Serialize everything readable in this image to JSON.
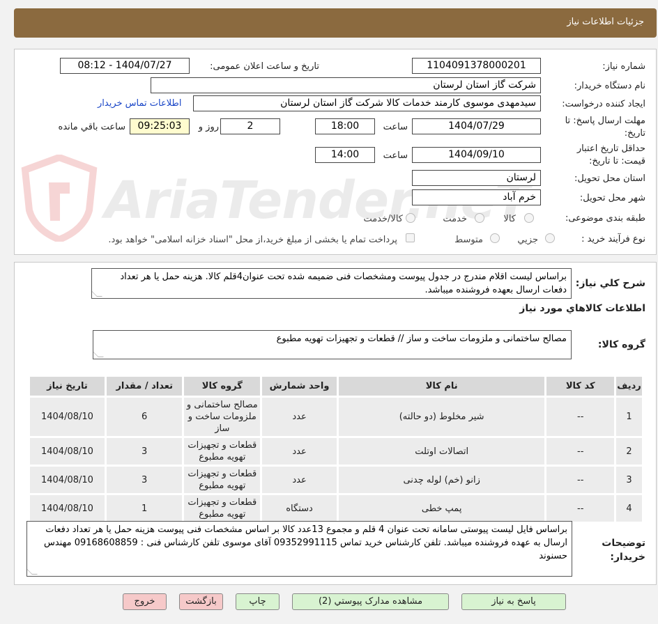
{
  "header": {
    "title": "جزئیات اطلاعات نیاز"
  },
  "form": {
    "need_number_label": "شماره نیاز:",
    "need_number": "1104091378000201",
    "announce_label": "تاریخ و ساعت اعلان عمومی:",
    "announce_value": "1404/07/27 - 08:12",
    "buyer_org_label": "نام دستگاه خریدار:",
    "buyer_org": "شرکت گاز استان لرستان",
    "requester_label": "ایجاد کننده درخواست:",
    "requester": "سیدمهدی موسوی کارمند خدمات کالا شرکت گاز استان لرستان",
    "contact_link": "اطلاعات تماس خریدار",
    "deadline_label_1": "مهلت ارسال پاسخ: تا",
    "deadline_label_2": "تاریخ:",
    "deadline_date": "1404/07/29",
    "time_label": "ساعت",
    "deadline_time": "18:00",
    "days_value": "2",
    "days_label": "روز و",
    "remaining_time": "09:25:03",
    "remaining_label": "ساعت باقي مانده",
    "validity_label_1": "حداقل تاریخ اعتبار",
    "validity_label_2": "قیمت: تا تاریخ:",
    "validity_date": "1404/09/10",
    "validity_time_label": "ساعت",
    "validity_time": "14:00",
    "province_label": "استان محل تحویل:",
    "province": "لرستان",
    "city_label": "شهر محل تحویل:",
    "city": "خرم آباد",
    "category_label": "طبقه بندی موضوعی:",
    "cat_goods": "کالا",
    "cat_service": "خدمت",
    "cat_goods_service": "کالا/خدمت",
    "process_label": "نوع فرآیند خرید :",
    "proc_partial": "جزیي",
    "proc_medium": "متوسط",
    "payment_note": "پرداخت تمام یا بخشی از مبلغ خرید،از محل \"اسناد خزانه اسلامی\" خواهد بود."
  },
  "summary": {
    "label": "شرح کلي نياز:",
    "text": "براساس لیست اقلام مندرج در جدول پیوست ومشخصات فنی ضمیمه شده تحت عنوان4قلم کالا. هزینه حمل یا هر تعداد دفعات ارسال بعهده فروشنده میباشد."
  },
  "goods": {
    "section_title": "اطلاعات کالاهاي مورد نياز",
    "group_label": "گروه کالا:",
    "group_text": "مصالح ساختمانی و ملزومات ساخت و ساز //  قطعات و تجهیزات تهویه مطبوع"
  },
  "table": {
    "headers": [
      "ردیف",
      "کد کالا",
      "نام کالا",
      "واحد شمارش",
      "گروه کالا",
      "تعداد / مقدار",
      "تاریخ نیاز"
    ],
    "rows": [
      {
        "row": "1",
        "code": "--",
        "name": "شیر مخلوط (دو حالته)",
        "unit": "عدد",
        "group": "مصالح ساختمانی و ملزومات ساخت و ساز",
        "qty": "6",
        "date": "1404/08/10"
      },
      {
        "row": "2",
        "code": "--",
        "name": "اتصالات اوتلت",
        "unit": "عدد",
        "group": "قطعات و تجهیزات تهویه مطبوع",
        "qty": "3",
        "date": "1404/08/10"
      },
      {
        "row": "3",
        "code": "--",
        "name": "زانو (خم) لوله چدنی",
        "unit": "عدد",
        "group": "قطعات و تجهیزات تهویه مطبوع",
        "qty": "3",
        "date": "1404/08/10"
      },
      {
        "row": "4",
        "code": "--",
        "name": "پمپ خطی",
        "unit": "دستگاه",
        "group": "قطعات و تجهیزات تهویه مطبوع",
        "qty": "1",
        "date": "1404/08/10"
      }
    ]
  },
  "notes": {
    "label_1": "توضیحات",
    "label_2": "خریدار:",
    "text": "براساس  فایل لیست پیوستی سامانه تحت عنوان 4 قلم و مجموع 13عدد کالا بر اساس مشخصات فنی پیوست هزینه حمل یا هر تعداد دفعات ارسال به عهده فروشنده میباشد. تلفن کارشناس خرید تماس 09352991115 آقای موسوی تلفن کارشناس فنی : 09168608859 مهندس حسنوند"
  },
  "buttons": {
    "reply": "پاسخ به نیاز",
    "attachments": "مشاهده مدارک پیوستي (2)",
    "print": "چاپ",
    "back": "بازگشت",
    "exit": "خروج"
  },
  "watermark": {
    "text": "AriaTender.neT"
  },
  "colors": {
    "header_bg": "#8b6a3f",
    "link": "#1a46c7",
    "button_green": "#d8f3d1",
    "button_red": "#f6c9c9",
    "remaining_bg": "#fffccf"
  }
}
